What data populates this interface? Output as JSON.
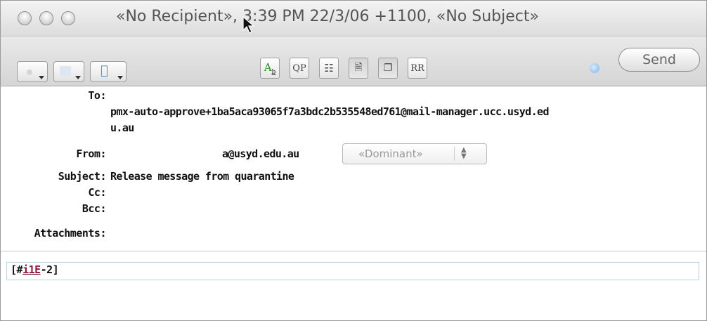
{
  "window": {
    "title": "«No Recipient», 3:39 PM 22/3/06 +1100, «No Subject»"
  },
  "toolbar": {
    "buttons": [
      "Ab",
      "QP",
      "RR"
    ],
    "send_label": "Send"
  },
  "header": {
    "to_label": "To:",
    "to_value_line1": "pmx-auto-approve+1ba5aca93065f7a3bdc2b535548ed761@mail-manager.ucc.usyd.ed",
    "to_value_line2": "u.au",
    "from_label": "From:",
    "from_value": "a@usyd.edu.au",
    "from_account": "«Dominant»",
    "subject_label": "Subject:",
    "subject_value": "Release message from quarantine",
    "cc_label": "Cc:",
    "bcc_label": "Bcc:",
    "attachments_label": "Attachments:"
  },
  "body": {
    "prefix": "[#",
    "link": "i1E",
    "suffix": "-2]"
  },
  "colors": {
    "link": "#8a1c3c",
    "send_text": "#666666"
  }
}
